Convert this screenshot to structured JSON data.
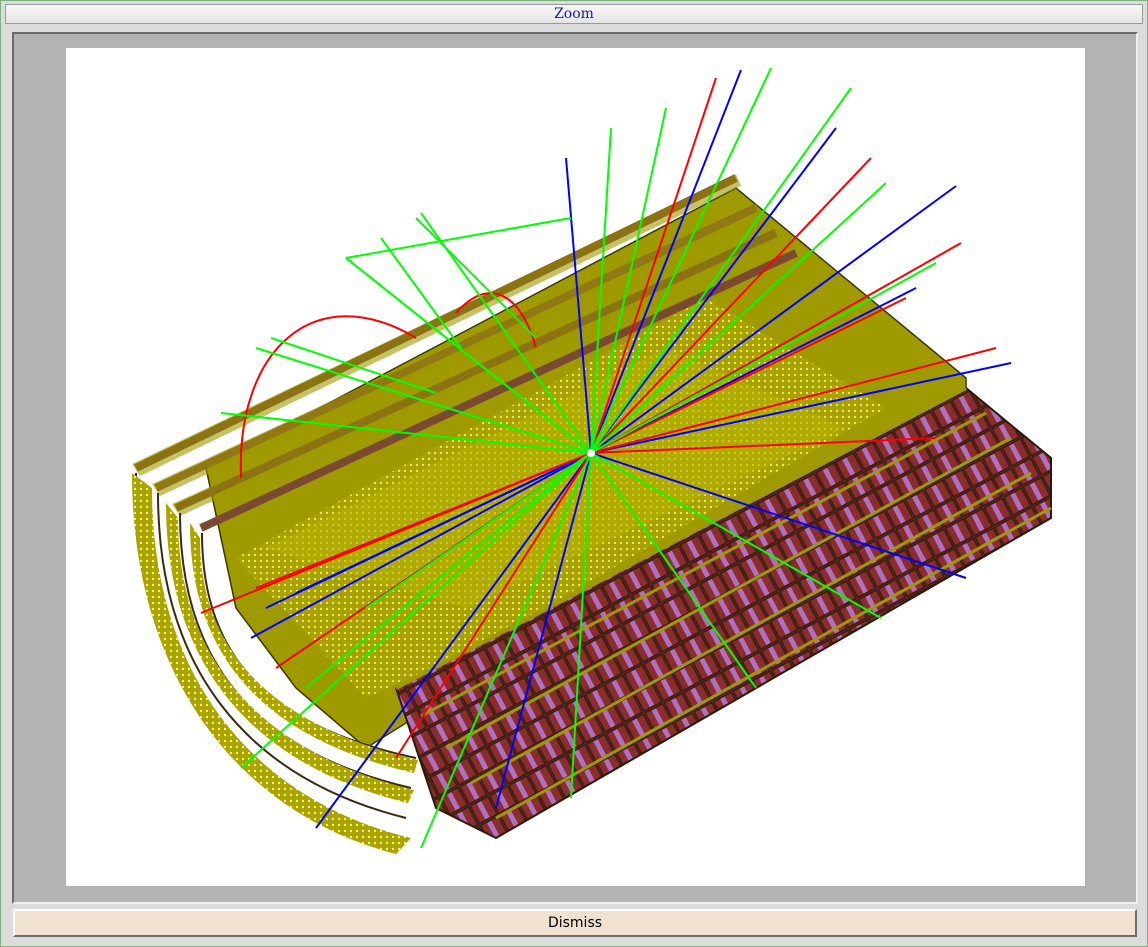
{
  "window": {
    "title": "Zoom"
  },
  "actions": {
    "dismiss_label": "Dismiss"
  },
  "colors": {
    "background": "#b3b3b3",
    "canvas": "#ffffff",
    "detector_yellow": "#9e9a00",
    "module_brown": "#6b3a2a",
    "track_red": "#ff0000",
    "track_green": "#00ff00",
    "track_blue": "#0000ff",
    "button": "#f1e1d1"
  }
}
